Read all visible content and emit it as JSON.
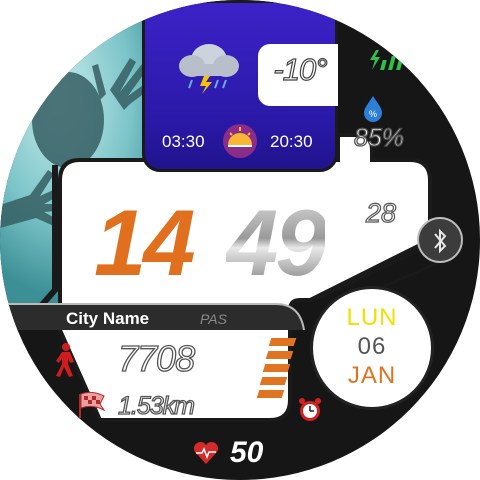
{
  "weather": {
    "icon": "thunderstorm-cloud-icon",
    "temperature": "-10°",
    "sunrise": "03:30",
    "sunset": "20:30",
    "sun_icon": "sunrise-sunset-icon"
  },
  "status": {
    "battery_icon": "battery-charging-icon",
    "humidity_icon": "humidity-drop-icon",
    "humidity": "85%"
  },
  "time": {
    "hour": "14",
    "minute": "49",
    "seconds": "28"
  },
  "bluetooth_icon": "bluetooth-icon",
  "city": {
    "name": "City Name",
    "tag": "PAS"
  },
  "activity": {
    "steps": "7708",
    "steps_icon": "walking-person-icon",
    "distance": "1.53km",
    "distance_icon": "flag-icon",
    "progress_bars": 5,
    "progress_filled": 5
  },
  "date": {
    "weekday": "LUN",
    "day": "06",
    "month": "JAN",
    "weekday_color": "#f0e000",
    "day_color": "#555555",
    "month_color": "#e07420"
  },
  "alarm_icon": "alarm-clock-icon",
  "heart": {
    "icon": "heart-rate-icon",
    "value": "50"
  },
  "colors": {
    "accent_orange": "#e0701e",
    "panel_blue": "#3020b8",
    "background": "#161616"
  }
}
